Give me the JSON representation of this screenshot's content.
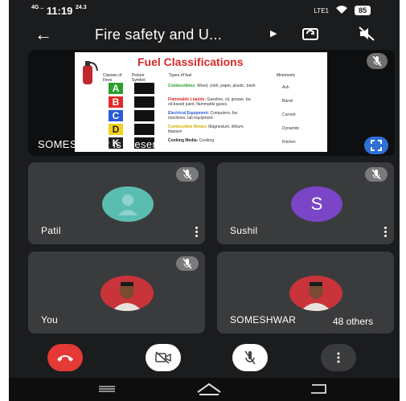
{
  "status": {
    "time": "11:19",
    "net_speed": "24.3",
    "carrier": "LTE1",
    "battery": "85"
  },
  "meeting": {
    "title": "Fire safety and U...",
    "back_label": "←"
  },
  "presentation": {
    "presenter_label": "SOMESHWAR is presenting",
    "slide": {
      "title": "Fuel Classifications",
      "headers": [
        "Classes of Fires",
        "Picture Symbol",
        "Types of fuel",
        "Mnemonic"
      ],
      "rows": [
        {
          "cls": "A",
          "color": "#2aa12a",
          "fuel_head": "Combustibles:",
          "fuel_body": "Wood, cloth, paper, plastic, trash.",
          "mnemonic": "Ash"
        },
        {
          "cls": "B",
          "color": "#e02a2a",
          "fuel_head": "Flammable Liquids:",
          "fuel_body": "Gasoline, oil, grease, tar, oil-based paint, flammable gases.",
          "mnemonic": "Barrel"
        },
        {
          "cls": "C",
          "color": "#2a5ad8",
          "fuel_head": "Electrical Equipment:",
          "fuel_body": "Computers, fax machines, lab equipment.",
          "mnemonic": "Current"
        },
        {
          "cls": "D",
          "color": "#f2d21a",
          "fuel_head": "Combustible Metals:",
          "fuel_body": "Magnesium, lithium, titanium",
          "mnemonic": "Dynamite"
        },
        {
          "cls": "K",
          "color": "#222222",
          "fuel_head": "Cooking Media:",
          "fuel_body": "Cooking",
          "mnemonic": "Kitchen"
        }
      ]
    }
  },
  "participants": [
    {
      "name": "Patil",
      "avatar_type": "icon",
      "color": "#5bbdb0"
    },
    {
      "name": "Sushil",
      "avatar_type": "letter",
      "letter": "S",
      "color": "#7b45c7"
    },
    {
      "name": "You",
      "avatar_type": "photo"
    },
    {
      "name": "SOMESHWAR",
      "avatar_type": "photo",
      "others_label": "48 others"
    }
  ],
  "controls": {
    "end_call": "end-call",
    "camera": "camera-off",
    "mic": "mic-off",
    "more": "more"
  }
}
